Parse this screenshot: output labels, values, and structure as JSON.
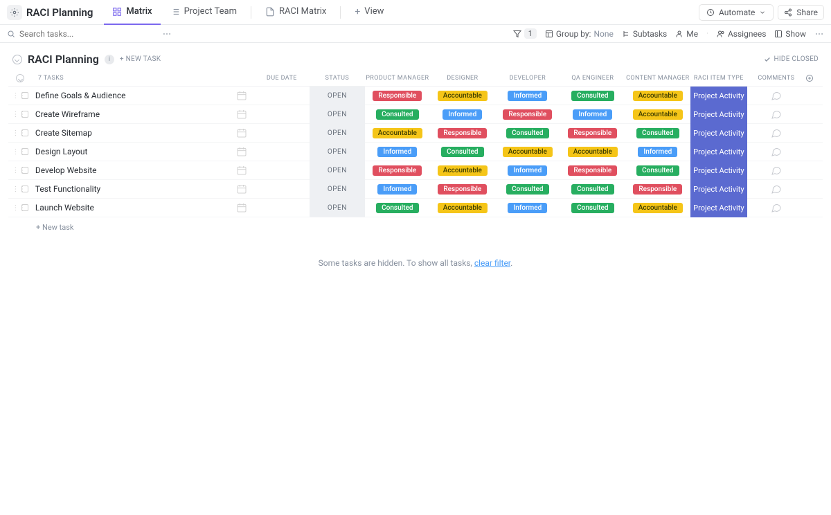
{
  "header": {
    "list_title": "RACI Planning",
    "tabs": [
      {
        "label": "Matrix",
        "active": true
      },
      {
        "label": "Project Team",
        "active": false
      },
      {
        "label": "RACI Matrix",
        "active": false
      }
    ],
    "view_btn": "View",
    "automate_btn": "Automate",
    "share_btn": "Share"
  },
  "toolbar": {
    "search_placeholder": "Search tasks...",
    "filter_count": "1",
    "group_by_label": "Group by:",
    "group_by_value": "None",
    "subtasks": "Subtasks",
    "me": "Me",
    "assignees": "Assignees",
    "show": "Show"
  },
  "section": {
    "title": "RACI Planning",
    "new_task": "+ NEW TASK",
    "hide_closed": "HIDE CLOSED",
    "task_count_label": "7 TASKS"
  },
  "columns": {
    "due": "DUE DATE",
    "status": "STATUS",
    "pm": "PRODUCT MANAGER",
    "des": "DESIGNER",
    "dev": "DEVELOPER",
    "qa": "QA ENGINEER",
    "cm": "CONTENT MANAGER",
    "type": "RACI ITEM TYPE",
    "comm": "COMMENTS"
  },
  "status_open": "OPEN",
  "type_label": "Project Activity",
  "tasks": [
    {
      "name": "Define Goals & Audience",
      "pm": "Responsible",
      "des": "Accountable",
      "dev": "Informed",
      "qa": "Consulted",
      "cm": "Accountable"
    },
    {
      "name": "Create Wireframe",
      "pm": "Consulted",
      "des": "Informed",
      "dev": "Responsible",
      "qa": "Informed",
      "cm": "Accountable"
    },
    {
      "name": "Create Sitemap",
      "pm": "Accountable",
      "des": "Responsible",
      "dev": "Consulted",
      "qa": "Responsible",
      "cm": "Consulted"
    },
    {
      "name": "Design Layout",
      "pm": "Informed",
      "des": "Consulted",
      "dev": "Accountable",
      "qa": "Accountable",
      "cm": "Informed"
    },
    {
      "name": "Develop Website",
      "pm": "Responsible",
      "des": "Accountable",
      "dev": "Informed",
      "qa": "Responsible",
      "cm": "Consulted"
    },
    {
      "name": "Test Functionality",
      "pm": "Informed",
      "des": "Responsible",
      "dev": "Consulted",
      "qa": "Consulted",
      "cm": "Responsible"
    },
    {
      "name": "Launch Website",
      "pm": "Consulted",
      "des": "Accountable",
      "dev": "Informed",
      "qa": "Consulted",
      "cm": "Accountable"
    }
  ],
  "footer": {
    "new_task": "+ New task",
    "hidden_msg": "Some tasks are hidden. To show all tasks, ",
    "clear_filter": "clear filter",
    "period": "."
  },
  "tag_class": {
    "Responsible": "t-resp",
    "Accountable": "t-acc",
    "Informed": "t-inf",
    "Consulted": "t-cons"
  }
}
